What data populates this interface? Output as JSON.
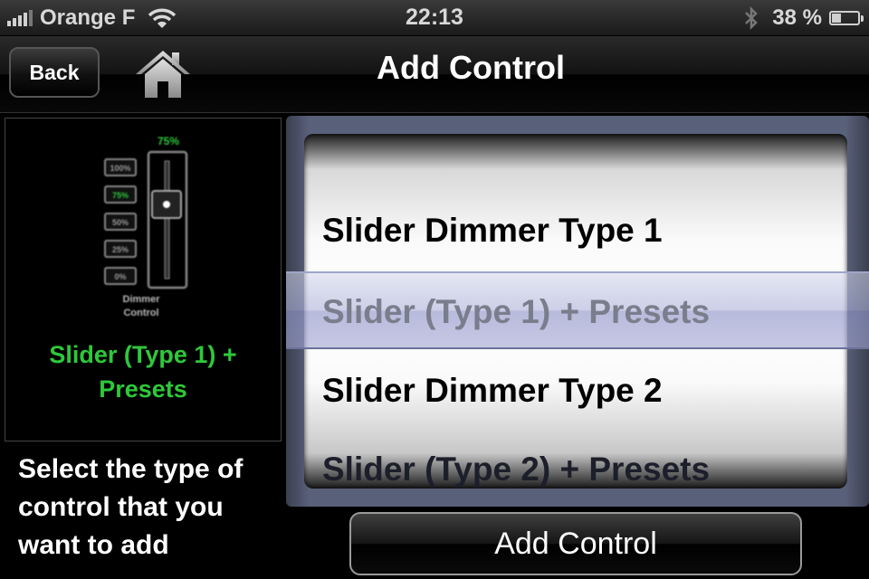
{
  "status_bar": {
    "carrier": "Orange F",
    "time": "22:13",
    "battery_percent": "38 %",
    "battery_level": 0.38,
    "icons": [
      "signal-icon",
      "wifi-icon",
      "bluetooth-icon",
      "battery-icon"
    ]
  },
  "nav": {
    "back_label": "Back",
    "home_icon": "home-icon",
    "title": "Add Control"
  },
  "preview": {
    "percent_label": "75%",
    "presets": [
      "100%",
      "75%",
      "50%",
      "25%",
      "0%"
    ],
    "active_preset": "75%",
    "caption_line1": "Dimmer",
    "caption_line2": "Control",
    "slider_level": 0.75,
    "label_line1": "Slider (Type 1) +",
    "label_line2": "Presets"
  },
  "instructions": "Select the type of control that you want to add",
  "picker": {
    "rows": [
      "Slider Dimmer Type 1",
      "Slider (Type 1) + Presets",
      "Slider Dimmer Type 2",
      "Slider (Type 2) + Presets"
    ],
    "selected": "Slider (Type 1) + Presets"
  },
  "add_button_label": "Add Control",
  "colors": {
    "accent_green": "#2ec83a",
    "background": "#000000",
    "picker_frame": "#59607a"
  }
}
